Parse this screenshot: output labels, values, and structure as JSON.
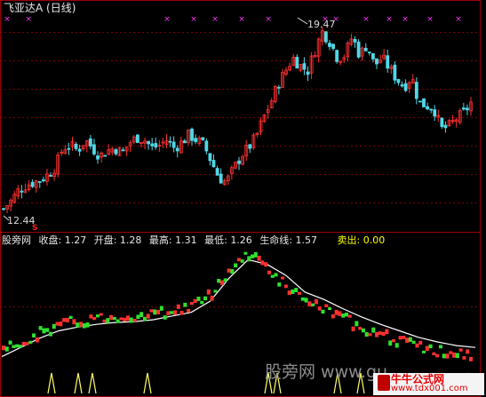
{
  "window": {
    "title": "飞亚达A (日线)"
  },
  "main_chart": {
    "high_label": "19.47",
    "low_label": "12.44",
    "signal_marker": "S",
    "grid": true,
    "colors": {
      "up": "#ff3030",
      "down": "#50d8e8",
      "marker": "#ff33ff",
      "grid": "#7a0000",
      "border": "#a00000"
    }
  },
  "indicator": {
    "name": "股旁网",
    "fields": [
      {
        "label": "收盘",
        "value": "1.27"
      },
      {
        "label": "开盘",
        "value": "1.28"
      },
      {
        "label": "最高",
        "value": "1.31"
      },
      {
        "label": "最低",
        "value": "1.26"
      },
      {
        "label": "生命线",
        "value": "1.57"
      }
    ],
    "sell_label": "卖出",
    "sell_value": "0.00",
    "colors": {
      "up": "#ff3030",
      "down": "#30e030",
      "lifeline": "#ffffff",
      "spike": "#ffff66"
    }
  },
  "watermark": {
    "center_text": "股旁网 www.gu",
    "logo_top": "牛牛公式网",
    "logo_bottom": "www.tdx001.com"
  },
  "chart_data": [
    {
      "type": "candlestick",
      "title": "飞亚达A (日线)",
      "price_high": 19.47,
      "price_low": 12.44,
      "annotations": [
        "19.47",
        "12.44",
        "S"
      ],
      "close_path": [
        12.6,
        12.9,
        13.3,
        13.5,
        13.6,
        13.7,
        13.9,
        14.2,
        14.9,
        15.0,
        14.8,
        15.2,
        14.9,
        14.6,
        14.8,
        14.9,
        14.7,
        15.1,
        15.3,
        15.2,
        14.9,
        15.0,
        15.2,
        14.9,
        15.1,
        15.4,
        15.2,
        15.0,
        14.4,
        13.8,
        13.6,
        14.1,
        14.6,
        14.9,
        15.3,
        16.0,
        16.6,
        17.3,
        17.8,
        18.3,
        18.0,
        17.8,
        18.6,
        19.3,
        18.9,
        18.3,
        18.4,
        19.1,
        18.4,
        18.8,
        18.0,
        18.3,
        17.9,
        17.5,
        17.2,
        17.6,
        16.6,
        16.5,
        16.4,
        15.6,
        15.7,
        16.0,
        16.2,
        16.6
      ]
    },
    {
      "type": "line",
      "title": "股旁网",
      "series": [
        {
          "name": "生命线",
          "values": [
            0.9,
            1.0,
            1.1,
            1.18,
            1.22,
            1.25,
            1.27,
            1.28,
            1.3,
            1.34,
            1.38,
            1.5,
            1.75,
            1.95,
            1.9,
            1.78,
            1.6,
            1.52,
            1.42,
            1.33,
            1.25,
            1.18,
            1.11,
            1.06,
            1.02,
            1.0
          ]
        }
      ],
      "spikes": 12
    }
  ]
}
